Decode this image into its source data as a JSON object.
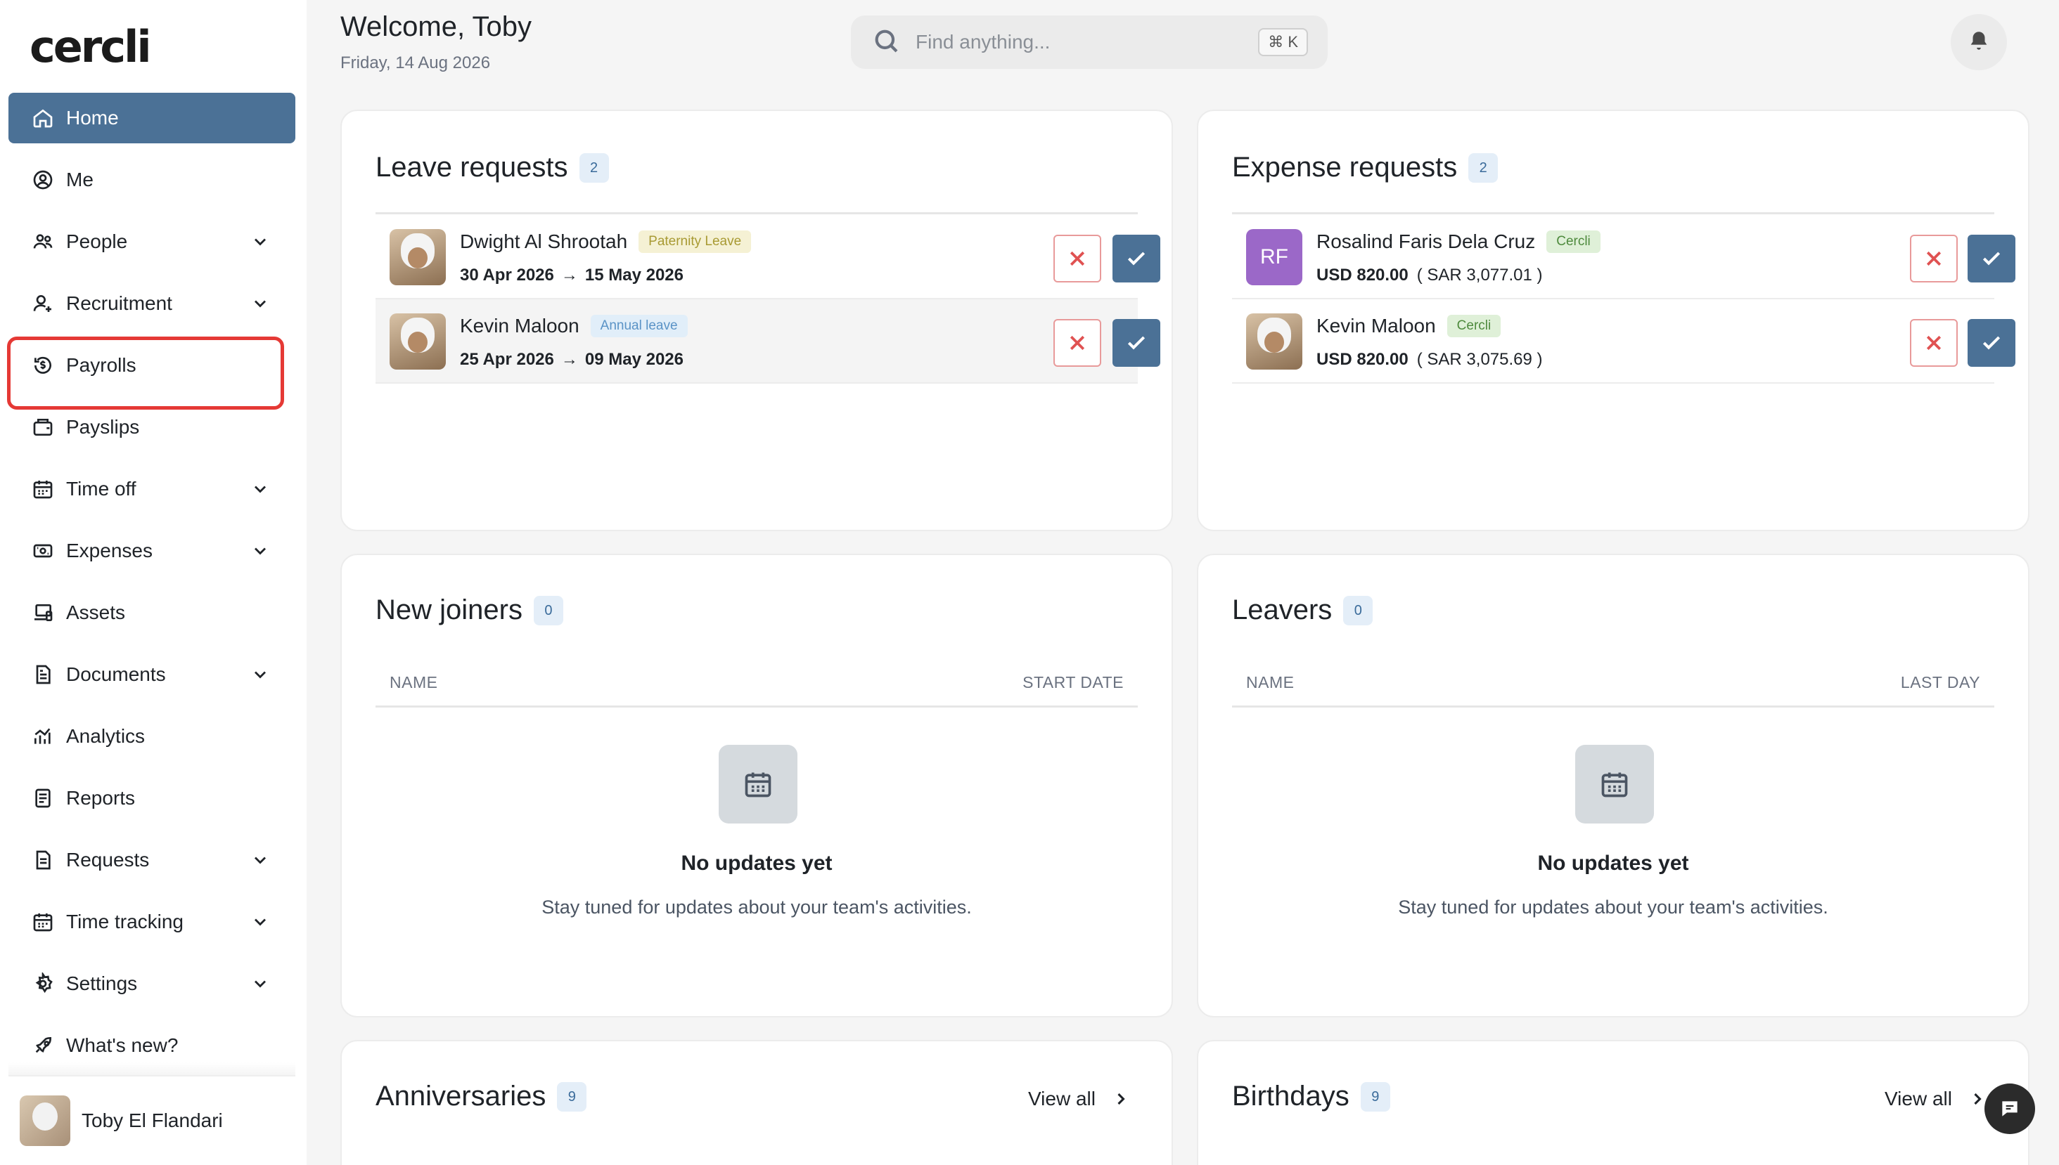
{
  "app": {
    "logo": "cercli"
  },
  "header": {
    "welcome": "Welcome, Toby",
    "date": "Friday, 14 Aug 2026",
    "search_placeholder": "Find anything...",
    "search_shortcut": "⌘ K"
  },
  "sidebar": {
    "items": [
      {
        "label": "Home",
        "icon": "home-icon",
        "active": true,
        "has_submenu": false
      },
      {
        "label": "Me",
        "icon": "user-circle-icon",
        "has_submenu": false
      },
      {
        "label": "People",
        "icon": "people-icon",
        "has_submenu": true
      },
      {
        "label": "Recruitment",
        "icon": "user-plus-icon",
        "has_submenu": true
      },
      {
        "label": "Payrolls",
        "icon": "payroll-icon",
        "has_submenu": false,
        "highlighted": true
      },
      {
        "label": "Payslips",
        "icon": "wallet-icon",
        "has_submenu": false
      },
      {
        "label": "Time off",
        "icon": "calendar-icon",
        "has_submenu": true
      },
      {
        "label": "Expenses",
        "icon": "receipt-icon",
        "has_submenu": true
      },
      {
        "label": "Assets",
        "icon": "devices-icon",
        "has_submenu": false
      },
      {
        "label": "Documents",
        "icon": "document-icon",
        "has_submenu": true
      },
      {
        "label": "Analytics",
        "icon": "analytics-icon",
        "has_submenu": false
      },
      {
        "label": "Reports",
        "icon": "report-icon",
        "has_submenu": false
      },
      {
        "label": "Requests",
        "icon": "requests-icon",
        "has_submenu": true
      },
      {
        "label": "Time tracking",
        "icon": "calendar-clock-icon",
        "has_submenu": true
      },
      {
        "label": "Settings",
        "icon": "gear-icon",
        "has_submenu": true
      },
      {
        "label": "What's new?",
        "icon": "rocket-icon",
        "has_submenu": false
      }
    ],
    "user": {
      "name": "Toby El Flandari"
    }
  },
  "leave_requests": {
    "title": "Leave requests",
    "count": "2",
    "rows": [
      {
        "name": "Dwight Al Shrootah",
        "tag": "Paternity Leave",
        "start": "30 Apr 2026",
        "end": "15 May 2026"
      },
      {
        "name": "Kevin Maloon",
        "tag": "Annual leave",
        "start": "25 Apr 2026",
        "end": "09 May 2026"
      }
    ]
  },
  "expense_requests": {
    "title": "Expense requests",
    "count": "2",
    "rows": [
      {
        "initials": "RF",
        "name": "Rosalind Faris Dela Cruz",
        "tag": "Cercli",
        "amount": "USD 820.00",
        "converted": "( SAR 3,077.01 )"
      },
      {
        "name": "Kevin Maloon",
        "tag": "Cercli",
        "amount": "USD 820.00",
        "converted": "( SAR 3,075.69 )"
      }
    ]
  },
  "new_joiners": {
    "title": "New joiners",
    "count": "0",
    "col_name": "NAME",
    "col_date": "START DATE",
    "empty_title": "No updates yet",
    "empty_sub": "Stay tuned for updates about your team's activities."
  },
  "leavers": {
    "title": "Leavers",
    "count": "0",
    "col_name": "NAME",
    "col_date": "LAST DAY",
    "empty_title": "No updates yet",
    "empty_sub": "Stay tuned for updates about your team's activities."
  },
  "anniversaries": {
    "title": "Anniversaries",
    "count": "9",
    "view_all": "View all"
  },
  "birthdays": {
    "title": "Birthdays",
    "count": "9",
    "view_all": "View all"
  },
  "colors": {
    "accent": "#4b7196",
    "highlight": "#e53935",
    "reject": "#e05252"
  }
}
